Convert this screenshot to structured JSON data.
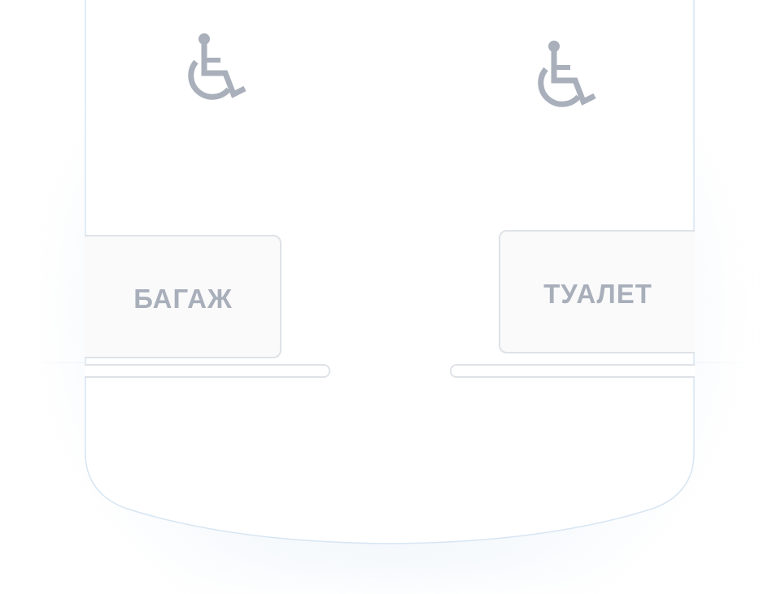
{
  "colors": {
    "icon": "#a9b0bb",
    "sign_text": "#a8afba",
    "sign_border": "#dfe2e7",
    "sign_fill": "#fafafb",
    "shell_edge": "#d7e5f3",
    "glow": "#e6eff8"
  },
  "icons": {
    "left": "wheelchair-icon",
    "right": "wheelchair-icon"
  },
  "signs": {
    "baggage": "БАГАЖ",
    "toilet": "ТУАЛЕТ"
  }
}
